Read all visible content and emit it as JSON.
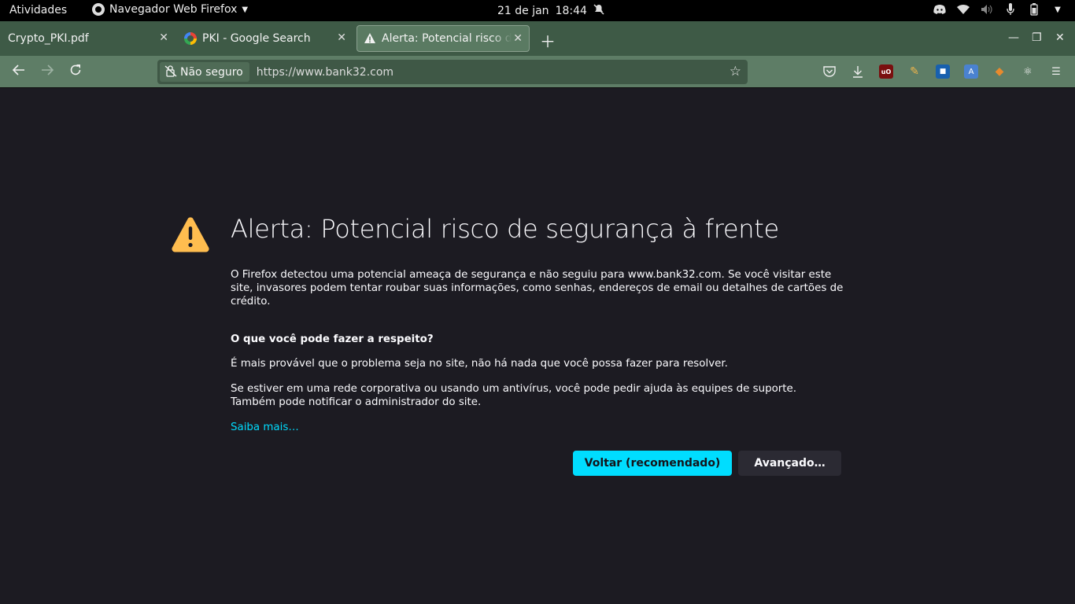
{
  "topbar": {
    "activities": "Atividades",
    "app_name": "Navegador Web Firefox",
    "date": "21 de jan",
    "time": "18:44"
  },
  "tabs": [
    {
      "title": "Crypto_PKI.pdf",
      "active": false
    },
    {
      "title": "PKI - Google Search",
      "active": false,
      "favicon": "google-icon"
    },
    {
      "title": "Alerta: Potencial risco de segurança à frente",
      "active": true,
      "favicon": "warning-icon"
    }
  ],
  "navbar": {
    "identity_label": "Não seguro",
    "url": "https://www.bank32.com"
  },
  "page": {
    "title": "Alerta: Potencial risco de segurança à frente",
    "intro": "O Firefox detectou uma potencial ameaça de segurança e não seguiu para www.bank32.com. Se você visitar este site, invasores podem tentar roubar suas informações, como senhas, endereços de email ou detalhes de cartões de crédito.",
    "what_heading": "O que você pode fazer a respeito?",
    "what_p1": "É mais provável que o problema seja no site, não há nada que você possa fazer para resolver.",
    "what_p2": "Se estiver em uma rede corporativa ou usando um antivírus, você pode pedir ajuda às equipes de suporte. Também pode notificar o administrador do site.",
    "learn_more": "Saiba mais…",
    "back_button": "Voltar (recomendado)",
    "advanced_button": "Avançado…"
  },
  "colors": {
    "accent": "#00ddff",
    "background": "#1c1b22",
    "toolbar": "#5e7d66",
    "tabstrip": "#3e5a46",
    "warning": "#ffbd4f"
  }
}
